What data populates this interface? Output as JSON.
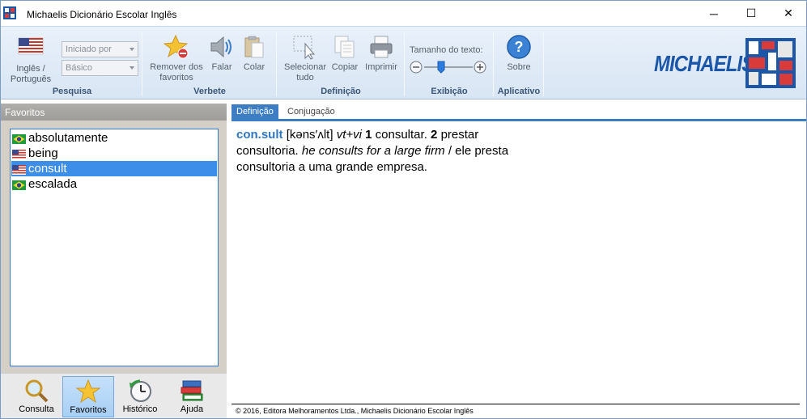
{
  "window": {
    "title": "Michaelis Dicionário Escolar Inglês",
    "controls": {
      "minimize": "─",
      "maximize": "☐",
      "close": "✕"
    }
  },
  "ribbon": {
    "groups": {
      "pesquisa": {
        "label": "Pesquisa",
        "language_button": "Inglês / Português",
        "search_mode": "Iniciado por",
        "level": "Básico"
      },
      "verbete": {
        "label": "Verbete",
        "remove_favorites": "Remover dos favoritos",
        "speak": "Falar",
        "paste": "Colar"
      },
      "definicao": {
        "label": "Definição",
        "select_all": "Selecionar tudo",
        "copy": "Copiar",
        "print": "Imprimir"
      },
      "exibicao": {
        "label": "Exibição",
        "text_size_label": "Tamanho do texto:",
        "text_size_level": 0.35
      },
      "aplicativo": {
        "label": "Aplicativo",
        "about": "Sobre"
      }
    },
    "logo": "MICHAELIS"
  },
  "favorites": {
    "header": "Favoritos",
    "items": [
      {
        "word": "absolutamente",
        "flag": "brazil-flag-icon"
      },
      {
        "word": "being",
        "flag": "usa-flag-icon"
      },
      {
        "word": "consult",
        "flag": "usa-flag-icon",
        "selected": true
      },
      {
        "word": "escalada",
        "flag": "brazil-flag-icon"
      }
    ]
  },
  "bottom_nav": {
    "consulta": "Consulta",
    "favoritos": "Favoritos",
    "historico": "Histórico",
    "ajuda": "Ajuda"
  },
  "content": {
    "tabs": {
      "definicao": "Definição",
      "conjugacao": "Conjugação"
    },
    "entry": {
      "headword": "con.sult",
      "pronunciation": "[kəns′ʌlt]",
      "pos": "vt+vi",
      "sense1_num": "1",
      "sense1": "consultar.",
      "sense2_num": "2",
      "sense2": "prestar consultoria.",
      "example": "he consults for a large firm",
      "example_sep": "/",
      "translation": "ele presta consultoria a uma grande empresa."
    },
    "footer": "© 2016, Editora Melhoramentos Ltda., Michaelis Dicionário Escolar Inglês"
  },
  "colors": {
    "accent": "#3c7dc4",
    "selection": "#3d8ee8",
    "brand": "#1b56a8"
  }
}
